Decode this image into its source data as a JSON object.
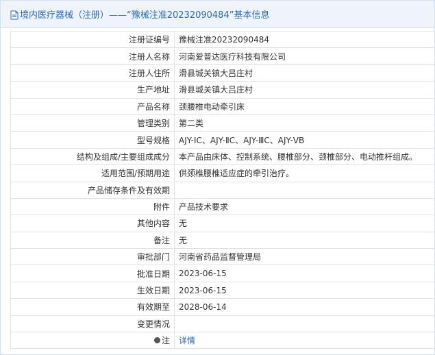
{
  "header": {
    "title": "境内医疗器械（注册）——“豫械注准20232090484”基本信息"
  },
  "rows": [
    {
      "label": "注册证编号",
      "value": "豫械注准20232090484"
    },
    {
      "label": "注册人名称",
      "value": "河南爱普达医疗科技有限公司"
    },
    {
      "label": "注册人住所",
      "value": "滑县城关镇大吕庄村"
    },
    {
      "label": "生产地址",
      "value": "滑县城关镇大吕庄村"
    },
    {
      "label": "产品名称",
      "value": "颈腰椎电动牵引床"
    },
    {
      "label": "管理类别",
      "value": "第二类"
    },
    {
      "label": "型号规格",
      "value": "AJY-ⅠC、AJY-ⅡC、AJY-ⅢC、AJY-ⅤB"
    },
    {
      "label": "结构及组成/主要组成成分",
      "value": "本产品由床体、控制系统、腰椎部分、颈椎部分、电动推杆组成。"
    },
    {
      "label": "适用范围/预期用途",
      "value": "供颈椎腰椎适应症的牵引治疗。"
    },
    {
      "label": "产品储存条件及有效期",
      "value": ""
    },
    {
      "label": "附件",
      "value": "产品技术要求"
    },
    {
      "label": "其他内容",
      "value": "无"
    },
    {
      "label": "备注",
      "value": "无"
    },
    {
      "label": "审批部门",
      "value": "河南省药品监督管理局"
    },
    {
      "label": "批准日期",
      "value": "2023-06-15"
    },
    {
      "label": "生效日期",
      "value": "2023-06-15"
    },
    {
      "label": "有效期至",
      "value": "2028-06-14"
    },
    {
      "label": "变更情况",
      "value": ""
    }
  ],
  "note_row": {
    "label": "注",
    "link_text": "详情"
  }
}
